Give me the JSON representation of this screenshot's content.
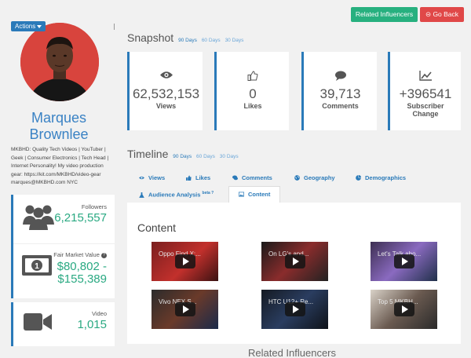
{
  "profile": {
    "actions_label": "Actions",
    "name_line1": "Marques",
    "name_line2": "Brownlee",
    "bio": "MKBHD: Quality Tech Videos | YouTuber | Geek | Consumer Electronics | Tech Head | Internet Personality! My video production gear: https://kit.com/MKBHD/video-gear marques@MKBHD.com NYC"
  },
  "stats": {
    "followers": {
      "label": "Followers",
      "value": "6,215,557",
      "icon": "users-icon"
    },
    "fmv": {
      "label": "Fair Market Value",
      "value_line1": "$80,802 -",
      "value_line2": "$155,389",
      "icon": "money-icon"
    },
    "video": {
      "label": "Video",
      "value": "1,015",
      "icon": "video-camera-icon"
    }
  },
  "header_buttons": {
    "related": "Related Influencers",
    "back": "Go Back"
  },
  "snapshot": {
    "title": "Snapshot",
    "periods": [
      "90 Days",
      "60 Days",
      "30 Days"
    ],
    "cards": [
      {
        "value": "62,532,153",
        "label": "Views",
        "icon": "eye-icon"
      },
      {
        "value": "0",
        "label": "Likes",
        "icon": "thumbs-up-icon"
      },
      {
        "value": "39,713",
        "label": "Comments",
        "icon": "comment-icon"
      },
      {
        "value": "+396541",
        "label_line1": "Subscriber",
        "label_line2": "Change",
        "icon": "line-chart-icon"
      }
    ]
  },
  "timeline": {
    "title": "Timeline",
    "periods": [
      "90 Days",
      "60 Days",
      "30 Days"
    ],
    "tabs": [
      {
        "label": "Views",
        "icon": "eye-icon"
      },
      {
        "label": "Likes",
        "icon": "thumbs-up-icon"
      },
      {
        "label": "Comments",
        "icon": "comments-icon"
      },
      {
        "label": "Geography",
        "icon": "globe-icon"
      },
      {
        "label": "Demographics",
        "icon": "pie-chart-icon"
      },
      {
        "label": "Audience Analysis",
        "badge": "beta ?",
        "icon": "flask-icon"
      },
      {
        "label": "Content",
        "icon": "image-icon"
      }
    ],
    "active_tab": "Content"
  },
  "content": {
    "title": "Content",
    "videos": [
      {
        "title": "Oppo Find X:..."
      },
      {
        "title": "On LG's and..."
      },
      {
        "title": "Let's Talk abo..."
      },
      {
        "title": "Vivo NEX S..."
      },
      {
        "title": "HTC U12+ Re..."
      },
      {
        "title": "Top 5 MKBH..."
      }
    ]
  },
  "related": {
    "title": "Related Influencers"
  },
  "colors": {
    "accent": "#2a7ab9",
    "green": "#2aa982",
    "related_btn": "#27b07f",
    "back_btn": "#e04848"
  }
}
